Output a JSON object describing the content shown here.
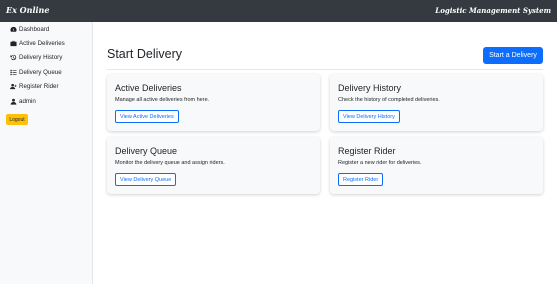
{
  "topbar": {
    "brand": "Ex Online",
    "system_title": "Logistic Management System"
  },
  "sidebar": {
    "items": [
      {
        "label": "Dashboard",
        "icon": "dashboard-icon"
      },
      {
        "label": "Active Deliveries",
        "icon": "briefcase-icon"
      },
      {
        "label": "Delivery History",
        "icon": "history-icon"
      },
      {
        "label": "Delivery Queue",
        "icon": "list-icon"
      },
      {
        "label": "Register Rider",
        "icon": "user-plus-icon"
      },
      {
        "label": "admin",
        "icon": "user-icon"
      }
    ],
    "logout_label": "Logout"
  },
  "main": {
    "title": "Start Delivery",
    "start_button": "Start a Delivery",
    "cards": [
      {
        "title": "Active Deliveries",
        "description": "Manage all active deliveries from here.",
        "button": "View Active Deliveries"
      },
      {
        "title": "Delivery History",
        "description": "Check the history of completed deliveries.",
        "button": "View Delivery History"
      },
      {
        "title": "Delivery Queue",
        "description": "Monitor the delivery queue and assign riders.",
        "button": "View Delivery Queue"
      },
      {
        "title": "Register Rider",
        "description": "Register a new rider for deliveries.",
        "button": "Register Rider"
      }
    ]
  },
  "colors": {
    "topbar": "#343a40",
    "sidebar": "#f8f9fa",
    "primary": "#0d6efd",
    "logout": "#ffc107"
  }
}
